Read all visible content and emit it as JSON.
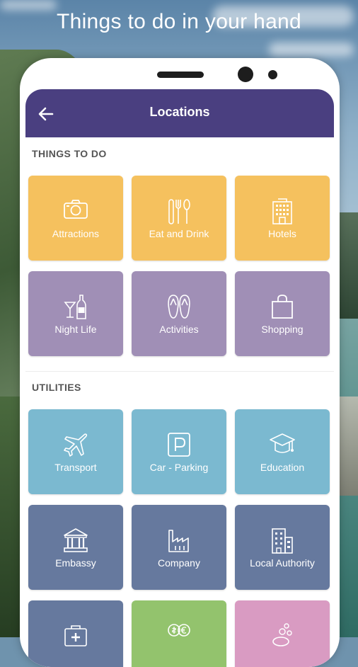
{
  "promo": {
    "headline": "Things to do in your hand"
  },
  "appbar": {
    "title": "Locations",
    "back_icon": "arrow-left-icon"
  },
  "sections": {
    "things_to_do": {
      "title": "THINGS TO DO",
      "tiles": [
        {
          "label": "Attractions",
          "icon": "camera-icon",
          "color": "#f5c15e"
        },
        {
          "label": "Eat and Drink",
          "icon": "cutlery-icon",
          "color": "#f5c15e"
        },
        {
          "label": "Hotels",
          "icon": "hotel-icon",
          "color": "#f5c15e"
        },
        {
          "label": "Night Life",
          "icon": "cocktail-icon",
          "color": "#a08fb6"
        },
        {
          "label": "Activities",
          "icon": "flip-flops-icon",
          "color": "#a08fb6"
        },
        {
          "label": "Shopping",
          "icon": "shopping-bag-icon",
          "color": "#a08fb6"
        }
      ]
    },
    "utilities": {
      "title": "UTILITIES",
      "tiles": [
        {
          "label": "Transport",
          "icon": "airplane-icon",
          "color": "#7bb9d0"
        },
        {
          "label": "Car - Parking",
          "icon": "parking-icon",
          "color": "#7bb9d0"
        },
        {
          "label": "Education",
          "icon": "graduation-cap-icon",
          "color": "#7bb9d0"
        },
        {
          "label": "Embassy",
          "icon": "bank-icon",
          "color": "#66799e"
        },
        {
          "label": "Company",
          "icon": "factory-icon",
          "color": "#66799e"
        },
        {
          "label": "Local Authority",
          "icon": "office-building-icon",
          "color": "#66799e"
        },
        {
          "label": "",
          "icon": "medical-kit-icon",
          "color": "#66799e"
        },
        {
          "label": "",
          "icon": "currency-exchange-icon",
          "color": "#93c36d"
        },
        {
          "label": "",
          "icon": "coins-icon",
          "color": "#d99bc2"
        }
      ]
    }
  }
}
